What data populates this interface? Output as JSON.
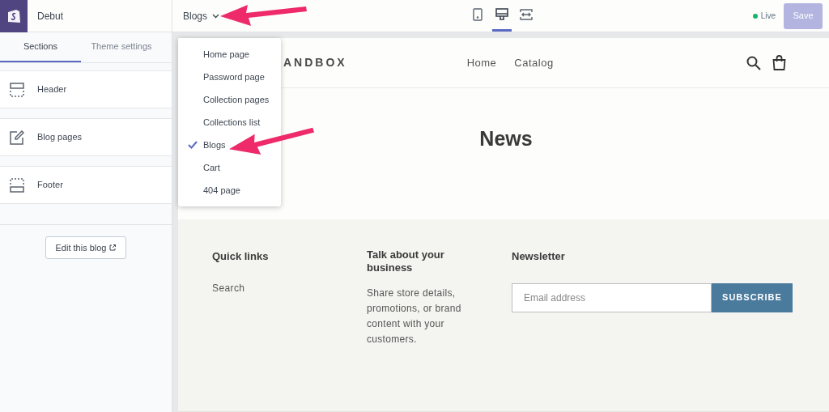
{
  "topbar": {
    "theme_name": "Debut",
    "page_picker": "Blogs",
    "devices": [
      {
        "kind": "mobile",
        "selected": false
      },
      {
        "kind": "desktop",
        "selected": true
      },
      {
        "kind": "fullwidth",
        "selected": false
      }
    ],
    "status": "Live",
    "save": "Save"
  },
  "sidebar": {
    "tabs": [
      {
        "label": "Sections",
        "selected": true
      },
      {
        "label": "Theme settings",
        "selected": false
      }
    ],
    "sections": [
      {
        "kind": "header",
        "label": "Header"
      },
      {
        "kind": "edit",
        "label": "Blog pages"
      },
      {
        "kind": "footer",
        "label": "Footer"
      }
    ],
    "edit_button": "Edit this blog"
  },
  "dropdown": {
    "items": [
      {
        "label": "Home page",
        "selected": false
      },
      {
        "label": "Password page",
        "selected": false
      },
      {
        "label": "Collection pages",
        "selected": false
      },
      {
        "label": "Collections list",
        "selected": false
      },
      {
        "label": "Blogs",
        "selected": true
      },
      {
        "label": "Cart",
        "selected": false
      },
      {
        "label": "404 page",
        "selected": false
      }
    ]
  },
  "preview": {
    "logo": "ANDBOX",
    "nav": [
      "Home",
      "Catalog"
    ],
    "title": "News",
    "footer": {
      "quick_links": {
        "heading": "Quick links",
        "links": [
          "Search"
        ]
      },
      "about": {
        "heading": "Talk about your business",
        "text": "Share store details, promotions, or brand content with your customers."
      },
      "newsletter": {
        "heading": "Newsletter",
        "placeholder": "Email address",
        "button": "SUBSCRIBE"
      }
    }
  }
}
